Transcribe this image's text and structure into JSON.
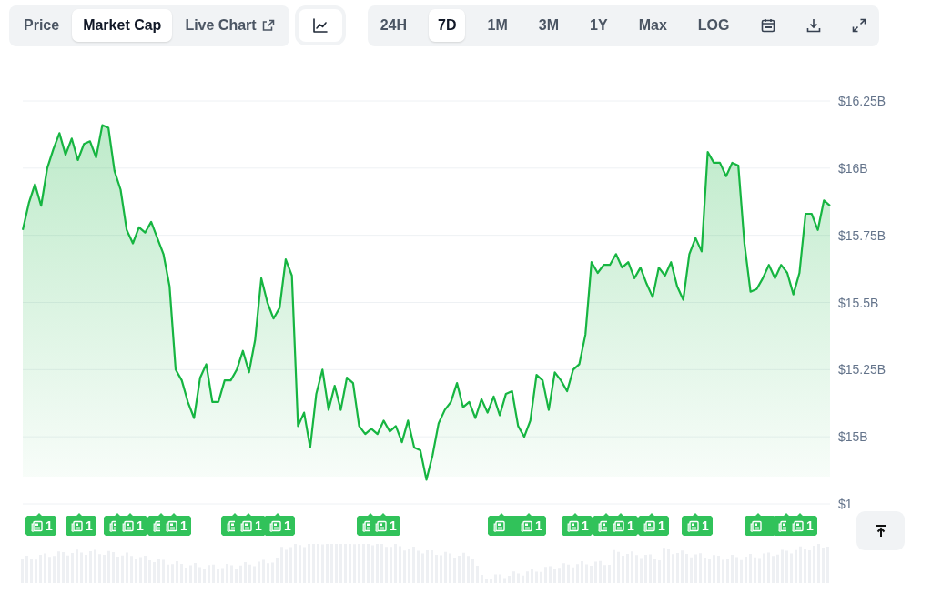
{
  "tabs": [
    {
      "label": "Price",
      "selected": false,
      "external": false
    },
    {
      "label": "Market Cap",
      "selected": true,
      "external": false
    },
    {
      "label": "Live Chart",
      "selected": false,
      "external": true
    }
  ],
  "ranges": [
    {
      "label": "24H",
      "selected": false
    },
    {
      "label": "7D",
      "selected": true
    },
    {
      "label": "1M",
      "selected": false
    },
    {
      "label": "3M",
      "selected": false
    },
    {
      "label": "1Y",
      "selected": false
    },
    {
      "label": "Max",
      "selected": false
    },
    {
      "label": "LOG",
      "selected": false
    }
  ],
  "chart": {
    "cut_tick_label": "$1",
    "chart_data": {
      "type": "area",
      "grid": true,
      "ylim": [
        14.75,
        16.25
      ],
      "yticks": [
        {
          "value": 16.25,
          "label": "$16.25B"
        },
        {
          "value": 16,
          "label": "$16B"
        },
        {
          "value": 15.75,
          "label": "$15.75B"
        },
        {
          "value": 15.5,
          "label": "$15.5B"
        },
        {
          "value": 15.25,
          "label": "$15.25B"
        },
        {
          "value": 15,
          "label": "$15B"
        }
      ],
      "series": [
        {
          "color": "#16b541",
          "values": [
            15.77,
            15.87,
            15.94,
            15.86,
            16.0,
            16.07,
            16.13,
            16.05,
            16.11,
            16.03,
            16.09,
            16.1,
            16.04,
            16.16,
            16.15,
            15.99,
            15.92,
            15.77,
            15.72,
            15.78,
            15.76,
            15.8,
            15.74,
            15.68,
            15.56,
            15.25,
            15.21,
            15.13,
            15.07,
            15.22,
            15.27,
            15.13,
            15.13,
            15.21,
            15.21,
            15.25,
            15.32,
            15.24,
            15.36,
            15.59,
            15.5,
            15.44,
            15.48,
            15.66,
            15.6,
            15.04,
            15.09,
            14.96,
            15.16,
            15.25,
            15.1,
            15.19,
            15.1,
            15.22,
            15.2,
            15.04,
            15.01,
            15.03,
            15.01,
            15.06,
            15.02,
            15.04,
            14.98,
            15.06,
            14.96,
            14.95,
            14.84,
            14.93,
            15.05,
            15.1,
            15.13,
            15.2,
            15.11,
            15.13,
            15.07,
            15.14,
            15.09,
            15.15,
            15.08,
            15.16,
            15.17,
            15.04,
            15.0,
            15.06,
            15.23,
            15.21,
            15.1,
            15.24,
            15.21,
            15.17,
            15.25,
            15.27,
            15.38,
            15.65,
            15.61,
            15.64,
            15.64,
            15.68,
            15.63,
            15.65,
            15.59,
            15.63,
            15.57,
            15.52,
            15.63,
            15.6,
            15.65,
            15.56,
            15.51,
            15.68,
            15.74,
            15.69,
            16.06,
            16.02,
            16.02,
            15.97,
            16.02,
            16.01,
            15.72,
            15.54,
            15.55,
            15.59,
            15.64,
            15.59,
            15.64,
            15.61,
            15.53,
            15.61,
            15.83,
            15.83,
            15.77,
            15.88,
            15.86
          ]
        }
      ]
    }
  },
  "news_markers": [
    {
      "kind": "badge",
      "count": "1"
    },
    {
      "kind": "badge",
      "count": "1"
    },
    {
      "kind": "covered"
    },
    {
      "kind": "badge",
      "count": "1"
    },
    {
      "kind": "covered"
    },
    {
      "kind": "badge",
      "count": "1"
    },
    {
      "kind": "covered"
    },
    {
      "kind": "badge",
      "count": "1"
    },
    {
      "kind": "badge",
      "count": "1"
    },
    {
      "kind": "covered"
    },
    {
      "kind": "badge",
      "count": "1"
    },
    {
      "kind": "covered"
    },
    {
      "kind": "badge",
      "count": "1"
    },
    {
      "kind": "badge",
      "count": "1"
    },
    {
      "kind": "covered"
    },
    {
      "kind": "badge",
      "count": "1"
    },
    {
      "kind": "badge",
      "count": "1"
    },
    {
      "kind": "badge",
      "count": "1"
    },
    {
      "kind": "covered"
    },
    {
      "kind": "covered"
    },
    {
      "kind": "badge",
      "count": "1"
    }
  ]
}
